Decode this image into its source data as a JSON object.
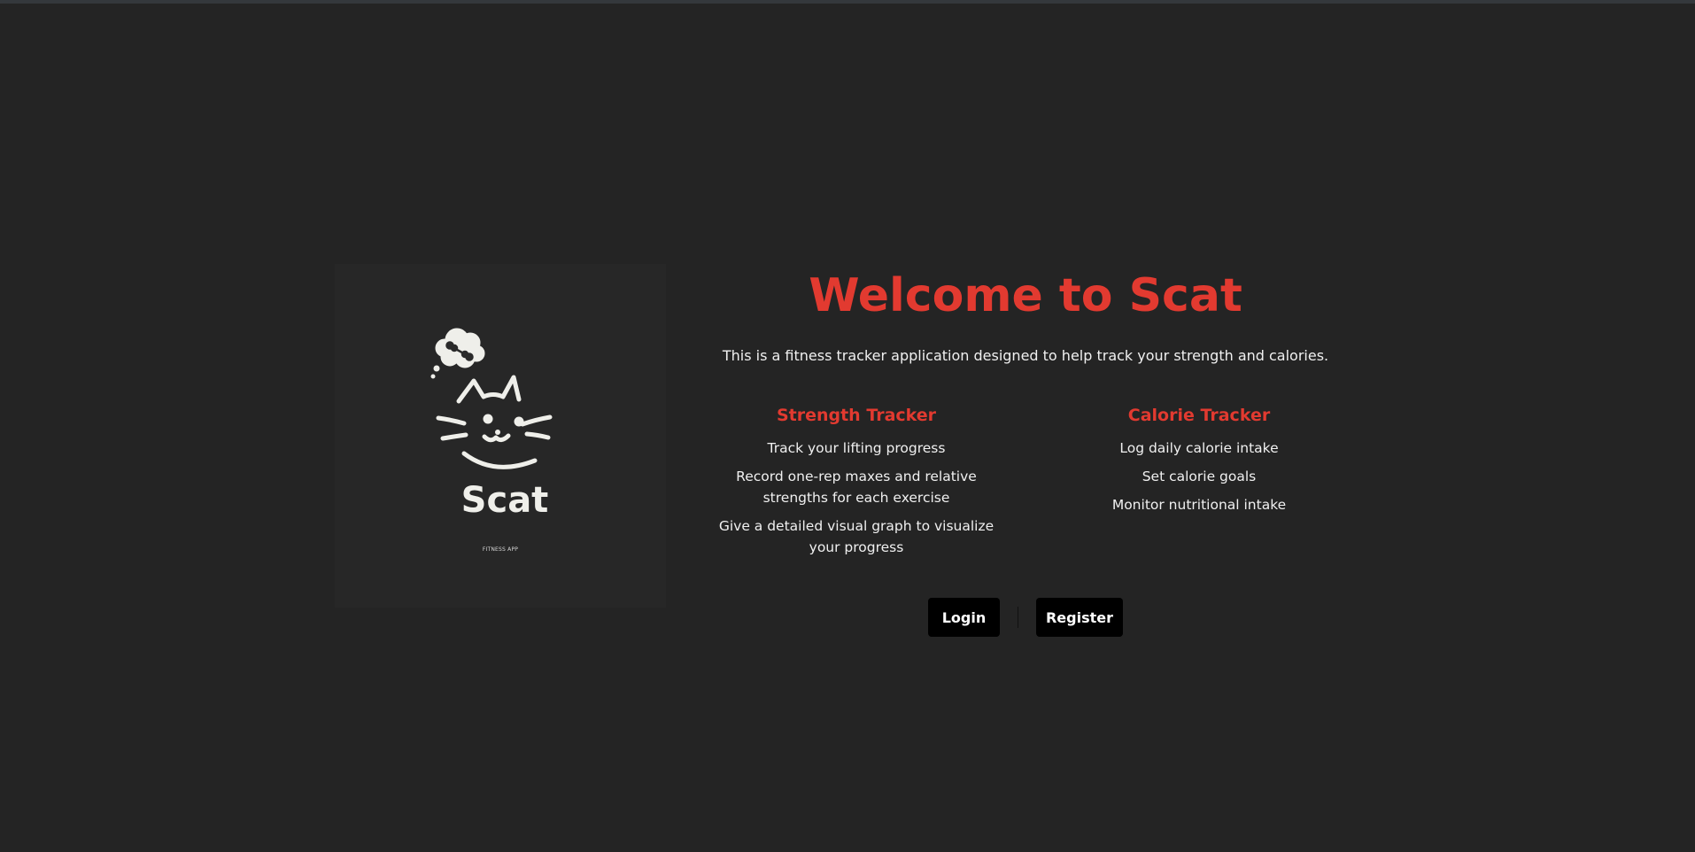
{
  "logo": {
    "wordmark": "Scat",
    "caption": "FITNESS APP",
    "icon": "cat-thinking-about-dumbbell-icon"
  },
  "hero": {
    "title": "Welcome to Scat",
    "intro": "This is a fitness tracker application designed to help track your strength and calories."
  },
  "features": {
    "strength": {
      "title": "Strength Tracker",
      "items": [
        "Track your lifting progress",
        "Record one-rep maxes and relative strengths for each exercise",
        "Give a detailed visual graph to visualize your progress"
      ]
    },
    "calorie": {
      "title": "Calorie Tracker",
      "items": [
        "Log daily calorie intake",
        "Set calorie goals",
        "Monitor nutritional intake"
      ]
    }
  },
  "actions": {
    "login_label": "Login",
    "register_label": "Register"
  },
  "colors": {
    "background": "#242424",
    "accent": "#e23a30",
    "button": "#000000",
    "text": "#f0f0f0"
  }
}
